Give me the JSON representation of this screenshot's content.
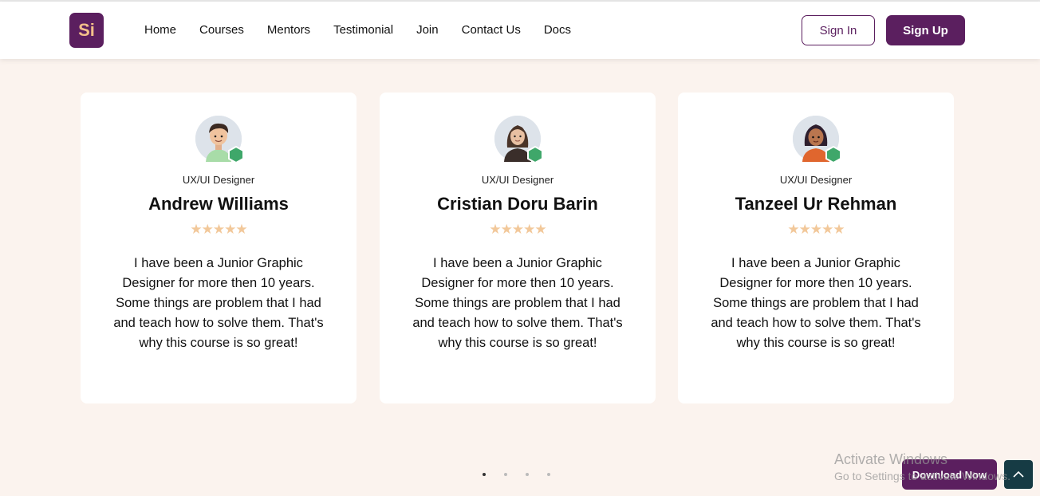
{
  "header": {
    "logo_text": "Si",
    "nav": [
      "Home",
      "Courses",
      "Mentors",
      "Testimonial",
      "Join",
      "Contact Us",
      "Docs"
    ],
    "signin_label": "Sign In",
    "signup_label": "Sign Up"
  },
  "testimonials": [
    {
      "role": "UX/UI Designer",
      "name": "Andrew Williams",
      "rating": 4.5,
      "stars": "★★★★★",
      "quote": "I have been a Junior Graphic Designer for more then 10 years. Some things are problem that I had and teach how to solve them. That's why this course is so great!"
    },
    {
      "role": "UX/UI Designer",
      "name": "Cristian Doru Barin",
      "rating": 4.5,
      "stars": "★★★★★",
      "quote": "I have been a Junior Graphic Designer for more then 10 years. Some things are problem that I had and teach how to solve them. That's why this course is so great!"
    },
    {
      "role": "UX/UI Designer",
      "name": "Tanzeel Ur Rehman",
      "rating": 4.5,
      "stars": "★★★★★",
      "quote": "I have been a Junior Graphic Designer for more then 10 years. Some things are problem that I had and teach how to solve them. That's why this course is so great!"
    }
  ],
  "carousel": {
    "page_count": 4,
    "active_index": 0
  },
  "watermark": {
    "line1": "Activate Windows",
    "line2": "Go to Settings to activate Windows."
  },
  "download_label": "Download Now",
  "colors": {
    "brand": "#5b1f5f",
    "accent": "#f3c08a",
    "star": "#f2c89a",
    "background": "#fbf3ee",
    "badge": "#3fa76a"
  },
  "icons": {
    "avatar_badge": "verified-hexagon-icon",
    "scroll_top": "chevron-up-icon"
  }
}
